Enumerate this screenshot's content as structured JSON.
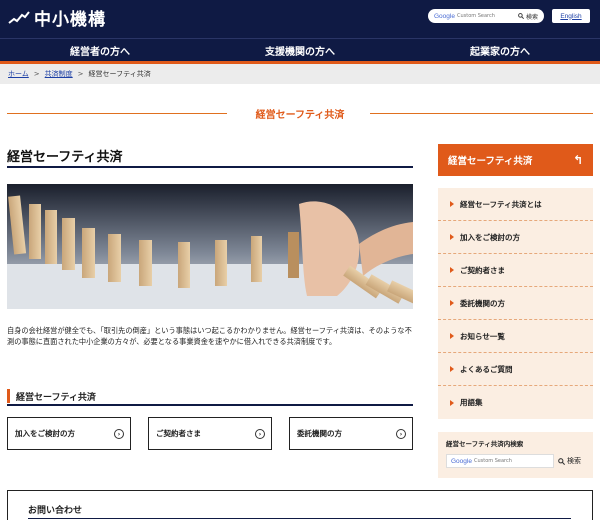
{
  "header": {
    "logo_text": "中小機構",
    "search_brand": "Google",
    "search_placeholder": "Custom Search",
    "search_button": "検索",
    "english_link": "English"
  },
  "global_nav": [
    {
      "label": "経営者の方へ"
    },
    {
      "label": "支援機関の方へ"
    },
    {
      "label": "起業家の方へ"
    }
  ],
  "breadcrumb": {
    "home": "ホーム",
    "level2": "共済制度",
    "current": "経営セーフティ共済",
    "separator": ">"
  },
  "section_title": "経営セーフティ共済",
  "main": {
    "page_title": "経営セーフティ共済",
    "intro": "自身の会社経営が健全でも、「取引先の倒産」という事態はいつ起こるかわかりません。経営セーフティ共済は、そのような不測の事態に直面された中小企業の方々が、必要となる事業資金を速やかに借入れできる共済制度です。",
    "subsection_title": "経営セーフティ共済",
    "cards": [
      {
        "label": "加入をご検討の方"
      },
      {
        "label": "ご契約者さま"
      },
      {
        "label": "委託機関の方"
      }
    ],
    "contact_title": "お問い合わせ"
  },
  "sidebar": {
    "heading": "経営セーフティ共済",
    "items": [
      {
        "label": "経営セーフティ共済とは"
      },
      {
        "label": "加入をご検討の方"
      },
      {
        "label": "ご契約者さま"
      },
      {
        "label": "委託機関の方"
      },
      {
        "label": "お知らせ一覧"
      },
      {
        "label": "よくあるご質問"
      },
      {
        "label": "用語集"
      }
    ],
    "search_label": "経営セーフティ共済内検索",
    "search_brand": "Google",
    "search_placeholder": "Custom Search",
    "search_button": "検索"
  },
  "colors": {
    "navy": "#0f1a44",
    "accent": "#e05a1a",
    "sidebar_bg": "#fbeee2",
    "link": "#1c3fa5"
  },
  "icons": [
    "logo-mark-icon",
    "search-icon",
    "back-arrow-icon",
    "arrow-right-circle-icon",
    "triangle-right-icon"
  ]
}
